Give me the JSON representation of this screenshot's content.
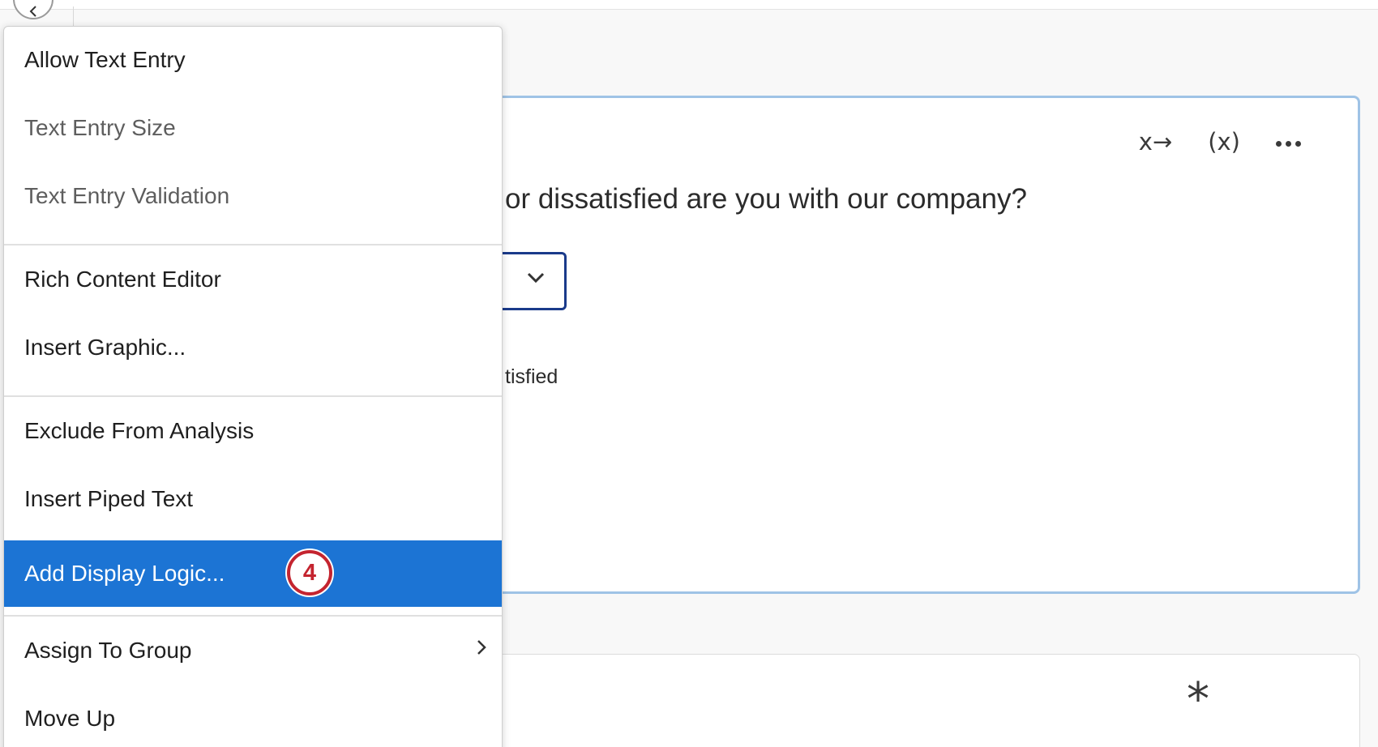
{
  "menu": {
    "items": [
      {
        "label": "Allow Text Entry"
      },
      {
        "label": "Text Entry Size"
      },
      {
        "label": "Text Entry Validation"
      },
      {
        "label": "Rich Content Editor"
      },
      {
        "label": "Insert Graphic..."
      },
      {
        "label": "Exclude From Analysis"
      },
      {
        "label": "Insert Piped Text"
      },
      {
        "label": "Add Display Logic..."
      },
      {
        "label": "Assign To Group"
      },
      {
        "label": "Move Up"
      }
    ],
    "highlight_color": "#1c74d4",
    "step_badge": "4",
    "step_badge_color": "#c4242f"
  },
  "question": {
    "text": "or dissatisfied are you with our company?",
    "answer_label": "tisfied",
    "tools": {
      "skip_logic_icon": "x→",
      "piped_text_icon": "(x)",
      "more_icon": "ellipsis-icon"
    },
    "card_border_color": "#9fc3e6"
  },
  "question_2": {
    "required_icon": "*"
  }
}
